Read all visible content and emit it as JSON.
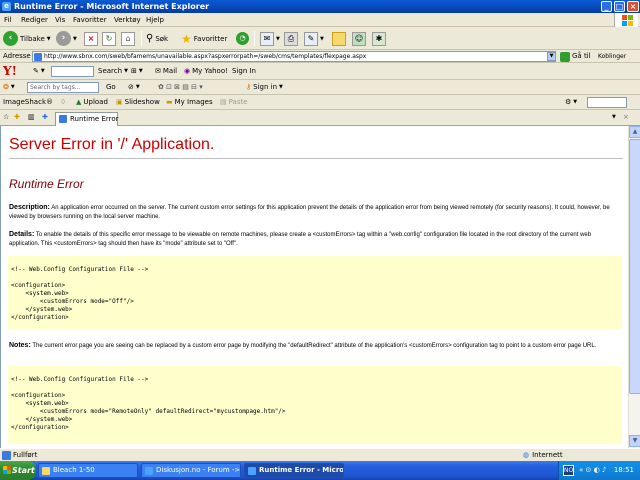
{
  "window": {
    "title": "Runtime Error - Microsoft Internet Explorer",
    "minimize": "_",
    "maximize": "□",
    "close": "×"
  },
  "menu": [
    "Fil",
    "Rediger",
    "Vis",
    "Favoritter",
    "Verktøy",
    "Hjelp"
  ],
  "toolbar": {
    "back": "Tilbake",
    "search": "Søk",
    "favorites": "Favoritter"
  },
  "address": {
    "label": "Adresse",
    "url": "http://www.sbnx.com/sweb/bfamems/unavailable.aspx?aspxerrorpath=/sweb/cms/templates/flexpage.aspx",
    "go": "Gå til",
    "links": "Koblinger"
  },
  "yahoo": {
    "logo": "Y!",
    "search_label": "Search",
    "mail": "Mail",
    "my_yahoo": "My Yahoo!",
    "sign_in": "Sign In"
  },
  "searchbar": {
    "placeholder": "Search by tags...",
    "go": "Go",
    "sign_in": "Sign in"
  },
  "imageshack": {
    "label": "ImageShack®",
    "upload": "Upload",
    "slideshow": "Slideshow",
    "my_images": "My Images",
    "paste": "Paste"
  },
  "tab": {
    "label": "Runtime Error"
  },
  "page": {
    "heading": "Server Error in '/' Application.",
    "subheading": "Runtime Error",
    "description_label": "Description:",
    "description_text": "An application error occurred on the server. The current custom error settings for this application prevent the details of the application error from being viewed remotely (for security reasons). It could, however, be viewed by browsers running on the local server machine.",
    "details_label": "Details:",
    "details_text": "To enable the details of this specific error message to be viewable on remote machines, please create a <customErrors> tag within a \"web.config\" configuration file located in the root directory of the current web application. This <customErrors> tag should then have its \"mode\" attribute set to \"Off\".",
    "code1": "<!-- Web.Config Configuration File -->\n\n<configuration>\n    <system.web>\n        <customErrors mode=\"Off\"/>\n    </system.web>\n</configuration>",
    "notes_label": "Notes:",
    "notes_text": "The current error page you are seeing can be replaced by a custom error page by modifying the \"defaultRedirect\" attribute of the application's <customErrors> configuration tag to point to a custom error page URL.",
    "code2": "<!-- Web.Config Configuration File -->\n\n<configuration>\n    <system.web>\n        <customErrors mode=\"RemoteOnly\" defaultRedirect=\"mycustompage.htm\"/>\n    </system.web>\n</configuration>"
  },
  "status": {
    "text": "Fullført",
    "zone": "Internett"
  },
  "taskbar": {
    "start": "Start",
    "tasks": [
      "Bleach 1-50",
      "Diskusjon.no - Forum -> ...",
      "Runtime Error - Micro..."
    ],
    "tray_lang": "NO",
    "clock": "18:51"
  },
  "colors": {
    "heading": "#cc0000",
    "subheading": "#800000",
    "codebox": "#ffffcc",
    "titlebar": "#0848b8"
  }
}
